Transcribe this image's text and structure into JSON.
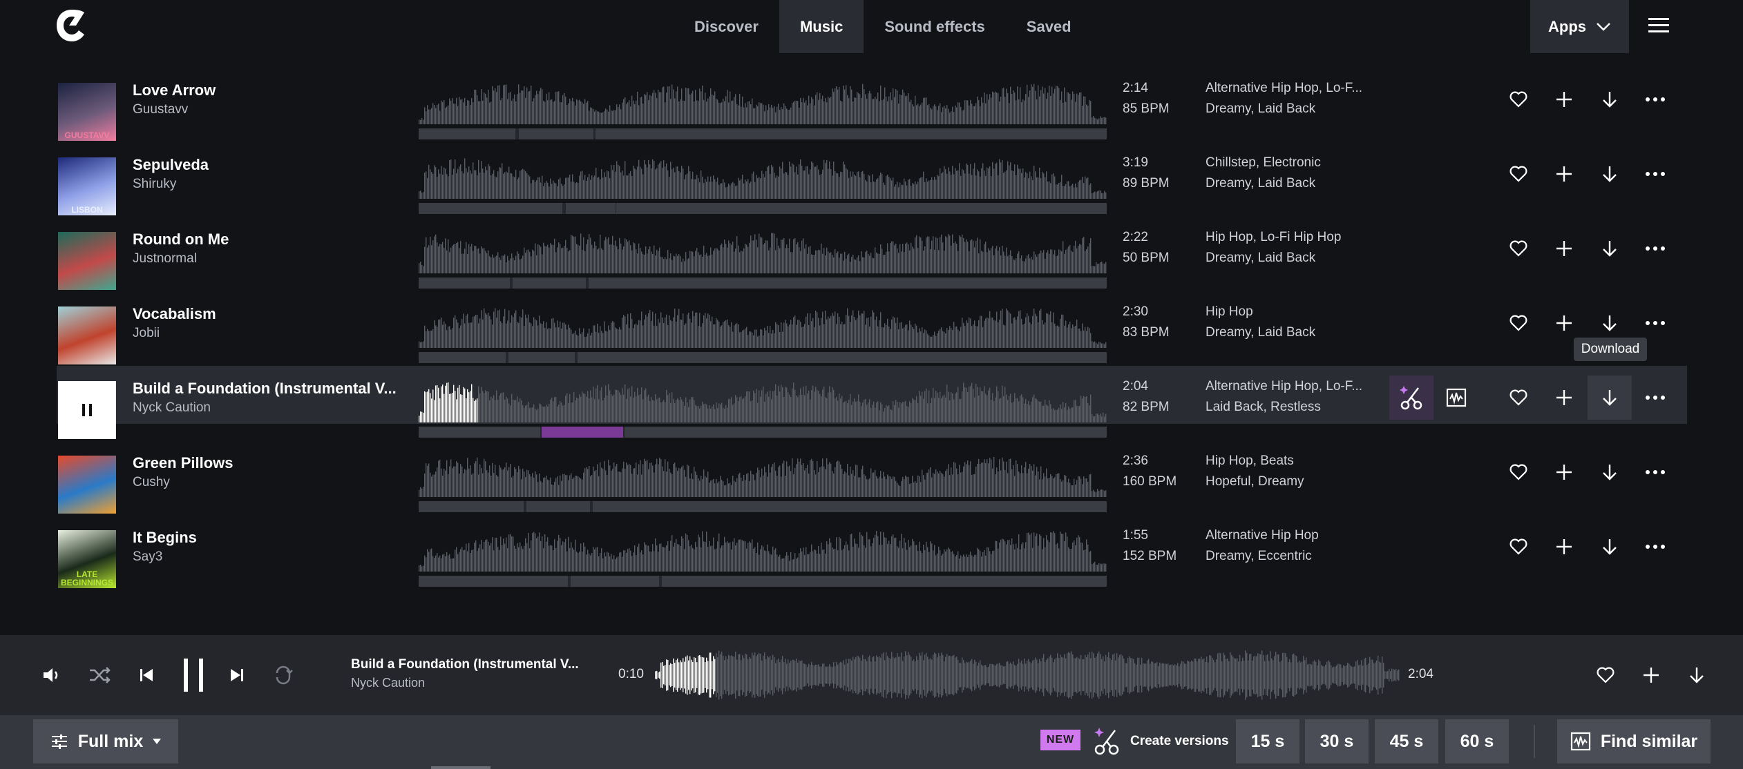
{
  "header": {
    "nav": [
      "Discover",
      "Music",
      "Sound effects",
      "Saved"
    ],
    "active_nav": "Music",
    "apps_label": "Apps"
  },
  "tracks": [
    {
      "title": "Love Arrow",
      "artist": "Guustavv",
      "duration": "2:14",
      "bpm": "85 BPM",
      "genres": "Alternative Hip Hop, Lo-F...",
      "moods": "Dreamy, Laid Back",
      "cover_text": "GUUSTAVV",
      "cover_colors": [
        "#1b2340",
        "#6d5a7a",
        "#f27da0"
      ]
    },
    {
      "title": "Sepulveda",
      "artist": "Shiruky",
      "duration": "3:19",
      "bpm": "89 BPM",
      "genres": "Chillstep, Electronic",
      "moods": "Dreamy, Laid Back",
      "cover_text": "LISBON",
      "cover_colors": [
        "#1d2a7a",
        "#8fa0e8",
        "#e8eefc"
      ]
    },
    {
      "title": "Round on Me",
      "artist": "Justnormal",
      "duration": "2:22",
      "bpm": "50 BPM",
      "genres": "Hip Hop, Lo-Fi Hip Hop",
      "moods": "Dreamy, Laid Back",
      "cover_text": "",
      "cover_colors": [
        "#1d6a5a",
        "#c24a4a",
        "#3ea890"
      ]
    },
    {
      "title": "Vocabalism",
      "artist": "Jobii",
      "duration": "2:30",
      "bpm": "83 BPM",
      "genres": "Hip Hop",
      "moods": "Dreamy, Laid Back",
      "cover_text": "",
      "cover_colors": [
        "#9fd0d8",
        "#c0432d",
        "#e8e8e8"
      ]
    },
    {
      "title": "Build a Foundation (Instrumental V...",
      "artist": "Nyck Caution",
      "duration": "2:04",
      "bpm": "82 BPM",
      "genres": "Alternative Hip Hop, Lo-F...",
      "moods": "Laid Back, Restless",
      "cover_text": "",
      "cover_colors": [
        "#ffffff",
        "#ffffff",
        "#ffffff"
      ],
      "playing": true
    },
    {
      "title": "Green Pillows",
      "artist": "Cushy",
      "duration": "2:36",
      "bpm": "160 BPM",
      "genres": "Hip Hop, Beats",
      "moods": "Hopeful, Dreamy",
      "cover_text": "",
      "cover_colors": [
        "#e84a2a",
        "#2a7ac8",
        "#f0a030"
      ]
    },
    {
      "title": "It Begins",
      "artist": "Say3",
      "duration": "1:55",
      "bpm": "152 BPM",
      "genres": "Alternative Hip Hop",
      "moods": "Dreamy, Eccentric",
      "cover_text": "LATE BEGINNINGS",
      "cover_colors": [
        "#e8f0e0",
        "#1a2a1a",
        "#b8e830"
      ]
    }
  ],
  "tooltip": "Download",
  "player": {
    "title": "Build a Foundation (Instrumental V...",
    "artist": "Nyck Caution",
    "current_time": "0:10",
    "total_time": "2:04",
    "progress": 0.081
  },
  "bottom": {
    "mix_label": "Full mix",
    "new_badge": "NEW",
    "create_versions": "Create versions",
    "durations": [
      "15 s",
      "30 s",
      "45 s",
      "60 s"
    ],
    "find_similar": "Find similar"
  },
  "colors": {
    "background": "#121317",
    "row_active": "#2a2c33",
    "waveform": "#5a5d64",
    "waveform_played": "#ffffff",
    "segment_highlight": "#7a3a95",
    "new_badge": "#d17af0"
  }
}
